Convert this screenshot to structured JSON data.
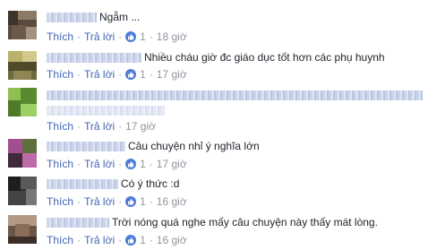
{
  "actions": {
    "like": "Thích",
    "reply": "Trả lời",
    "separator": "·"
  },
  "colors": {
    "link": "#4267b2",
    "meta": "#90949c",
    "like_badge": "#4c7bd9"
  },
  "comments": [
    {
      "text": "Ngẫm ...",
      "likes": "1",
      "time": "18 giờ"
    },
    {
      "text": "Nhiều cháu giờ đc giáo dục tốt hơn các phụ huynh",
      "likes": "1",
      "time": "17 giờ"
    },
    {
      "text": "",
      "likes": "",
      "time": "17 giờ"
    },
    {
      "text": "Câu chuyện nhỉ ý nghĩa lớn",
      "likes": "1",
      "time": "17 giờ"
    },
    {
      "text": "Có ý thức :d",
      "likes": "1",
      "time": "16 giờ"
    },
    {
      "text": "Trời nóng quá nghe mấy câu chuyện này thấy mát lòng.",
      "likes": "1",
      "time": "16 giờ"
    }
  ],
  "icons": {
    "like": "thumbs-up-icon"
  }
}
